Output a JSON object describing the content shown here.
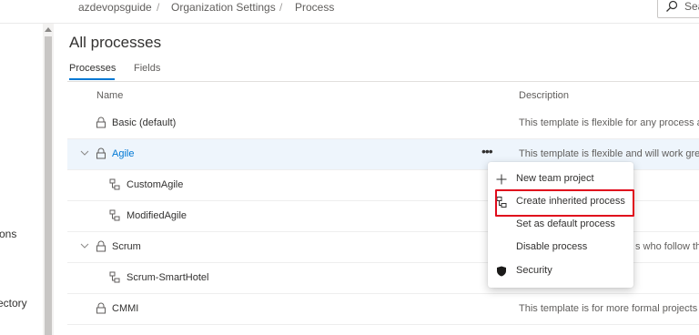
{
  "breadcrumb": {
    "org": "azdevopsguide",
    "separator": "/",
    "settings": "Organization Settings",
    "current": "Process"
  },
  "search": {
    "placeholder_visible": "Sea",
    "icon": "search-icon"
  },
  "leftnav": {
    "items": [
      "ons",
      "ectory"
    ]
  },
  "page": {
    "title": "All processes"
  },
  "tabs": [
    {
      "label": "Processes",
      "active": true
    },
    {
      "label": "Fields",
      "active": false
    }
  ],
  "table": {
    "columns": {
      "name": "Name",
      "description": "Description"
    },
    "rows": [
      {
        "name": "Basic (default)",
        "description": "This template is flexible for any process a",
        "type": "system",
        "expanded": null
      },
      {
        "name": "Agile",
        "description": "This template is flexible and will work gre",
        "type": "system",
        "expanded": true,
        "selected": true
      },
      {
        "name": "CustomAgile",
        "description": "",
        "type": "inherited"
      },
      {
        "name": "ModifiedAgile",
        "description": "",
        "type": "inherited"
      },
      {
        "name": "Scrum",
        "description": "s who follow the",
        "type": "system",
        "expanded": true
      },
      {
        "name": "Scrum-SmartHotel",
        "description": "",
        "type": "inherited"
      },
      {
        "name": "CMMI",
        "description": "This template is for more formal projects",
        "type": "system",
        "expanded": null
      }
    ]
  },
  "more_actions": {
    "label": "•••"
  },
  "context_menu": {
    "items": [
      {
        "label": "New team project",
        "icon": "plus-icon"
      },
      {
        "label": "Create inherited process",
        "icon": "inherit-icon",
        "highlighted": true
      },
      {
        "label": "Set as default process",
        "icon": ""
      },
      {
        "label": "Disable process",
        "icon": ""
      },
      {
        "label": "Security",
        "icon": "shield-icon"
      }
    ]
  },
  "colors": {
    "accent": "#0078d4",
    "highlight_box": "#e00b1c",
    "selected_row": "#eef5fc"
  }
}
